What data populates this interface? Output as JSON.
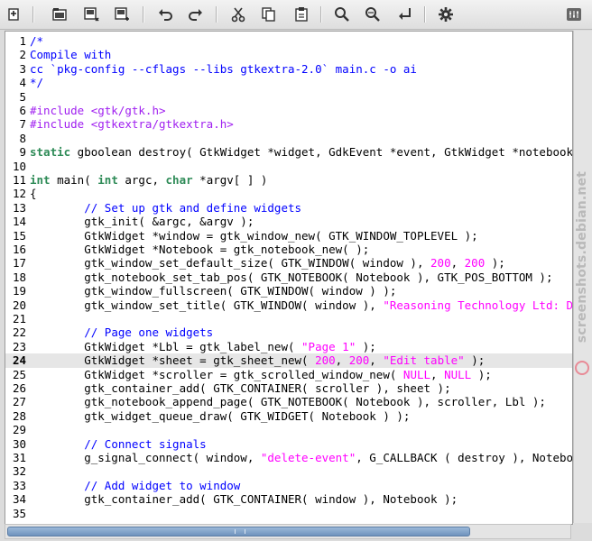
{
  "toolbar": {
    "buttons": [
      {
        "icon": "new-file-icon"
      },
      {
        "icon": "open-file-icon"
      },
      {
        "icon": "save-file-icon"
      },
      {
        "icon": "save-as-icon"
      },
      {
        "icon": "undo-icon"
      },
      {
        "icon": "redo-icon"
      },
      {
        "icon": "cut-icon"
      },
      {
        "icon": "copy-icon"
      },
      {
        "icon": "paste-icon"
      },
      {
        "icon": "find-icon"
      },
      {
        "icon": "find-next-icon"
      },
      {
        "icon": "goto-line-icon"
      },
      {
        "icon": "preferences-icon"
      },
      {
        "icon": "window-menu-icon"
      }
    ]
  },
  "editor": {
    "current_line": 24,
    "lines": [
      {
        "n": "1",
        "segs": [
          {
            "t": "/*",
            "c": "cmt"
          }
        ]
      },
      {
        "n": "2",
        "segs": [
          {
            "t": "Compile with",
            "c": "cmt"
          }
        ]
      },
      {
        "n": "3",
        "segs": [
          {
            "t": "cc `pkg-config --cflags --libs gtkextra-2.0` main.c -o ai",
            "c": "cmt"
          }
        ]
      },
      {
        "n": "4",
        "segs": [
          {
            "t": "*/",
            "c": "cmt"
          }
        ]
      },
      {
        "n": "5",
        "segs": []
      },
      {
        "n": "6",
        "segs": [
          {
            "t": "#include <gtk/gtk.h>",
            "c": "pre"
          }
        ]
      },
      {
        "n": "7",
        "segs": [
          {
            "t": "#include <gtkextra/gtkextra.h>",
            "c": "pre"
          }
        ]
      },
      {
        "n": "8",
        "segs": []
      },
      {
        "n": "9",
        "segs": [
          {
            "t": "static",
            "c": "kw"
          },
          {
            "t": " gboolean destroy( GtkWidget *widget, GdkEvent *event, GtkWidget *notebook"
          }
        ]
      },
      {
        "n": "10",
        "segs": []
      },
      {
        "n": "11",
        "segs": [
          {
            "t": "int",
            "c": "kw"
          },
          {
            "t": " main( "
          },
          {
            "t": "int",
            "c": "kw"
          },
          {
            "t": " argc, "
          },
          {
            "t": "char",
            "c": "kw"
          },
          {
            "t": " *argv[ ] )"
          }
        ]
      },
      {
        "n": "12",
        "segs": [
          {
            "t": "{"
          }
        ]
      },
      {
        "n": "13",
        "segs": [
          {
            "t": "        "
          },
          {
            "t": "// Set up gtk and define widgets",
            "c": "cmt"
          }
        ]
      },
      {
        "n": "14",
        "segs": [
          {
            "t": "        gtk_init( &argc, &argv );"
          }
        ]
      },
      {
        "n": "15",
        "segs": [
          {
            "t": "        GtkWidget *window = gtk_window_new( GTK_WINDOW_TOPLEVEL );"
          }
        ]
      },
      {
        "n": "16",
        "segs": [
          {
            "t": "        GtkWidget *Notebook = gtk_notebook_new( );"
          }
        ]
      },
      {
        "n": "17",
        "segs": [
          {
            "t": "        gtk_window_set_default_size( GTK_WINDOW( window ), "
          },
          {
            "t": "200",
            "c": "num"
          },
          {
            "t": ", "
          },
          {
            "t": "200",
            "c": "num"
          },
          {
            "t": " );"
          }
        ]
      },
      {
        "n": "18",
        "segs": [
          {
            "t": "        gtk_notebook_set_tab_pos( GTK_NOTEBOOK( Notebook ), GTK_POS_BOTTOM );"
          }
        ]
      },
      {
        "n": "19",
        "segs": [
          {
            "t": "        gtk_window_fullscreen( GTK_WINDOW( window ) );"
          }
        ]
      },
      {
        "n": "20",
        "segs": [
          {
            "t": "        gtk_window_set_title( GTK_WINDOW( window ), "
          },
          {
            "t": "\"Reasoning Technology Ltd: Dri",
            "c": "str"
          }
        ]
      },
      {
        "n": "21",
        "segs": []
      },
      {
        "n": "22",
        "segs": [
          {
            "t": "        "
          },
          {
            "t": "// Page one widgets",
            "c": "cmt"
          }
        ]
      },
      {
        "n": "23",
        "segs": [
          {
            "t": "        GtkWidget *Lbl = gtk_label_new( "
          },
          {
            "t": "\"Page 1\"",
            "c": "str"
          },
          {
            "t": " );"
          }
        ]
      },
      {
        "n": "24",
        "segs": [
          {
            "t": "        GtkWidget *sheet = gtk_sheet_new( "
          },
          {
            "t": "200",
            "c": "num"
          },
          {
            "t": ", "
          },
          {
            "t": "200",
            "c": "num"
          },
          {
            "t": ", "
          },
          {
            "t": "\"Edit table\"",
            "c": "str"
          },
          {
            "t": " );"
          }
        ]
      },
      {
        "n": "25",
        "segs": [
          {
            "t": "        GtkWidget *scroller = gtk_scrolled_window_new( "
          },
          {
            "t": "NULL",
            "c": "num"
          },
          {
            "t": ", "
          },
          {
            "t": "NULL",
            "c": "num"
          },
          {
            "t": " );"
          }
        ]
      },
      {
        "n": "26",
        "segs": [
          {
            "t": "        gtk_container_add( GTK_CONTAINER( scroller ), sheet );"
          }
        ]
      },
      {
        "n": "27",
        "segs": [
          {
            "t": "        gtk_notebook_append_page( GTK_NOTEBOOK( Notebook ), scroller, Lbl );"
          }
        ]
      },
      {
        "n": "28",
        "segs": [
          {
            "t": "        gtk_widget_queue_draw( GTK_WIDGET( Notebook ) );"
          }
        ]
      },
      {
        "n": "29",
        "segs": []
      },
      {
        "n": "30",
        "segs": [
          {
            "t": "        "
          },
          {
            "t": "// Connect signals",
            "c": "cmt"
          }
        ]
      },
      {
        "n": "31",
        "segs": [
          {
            "t": "        g_signal_connect( window, "
          },
          {
            "t": "\"delete-event\"",
            "c": "str"
          },
          {
            "t": ", G_CALLBACK ( destroy ), Notebook"
          }
        ]
      },
      {
        "n": "32",
        "segs": []
      },
      {
        "n": "33",
        "segs": [
          {
            "t": "        "
          },
          {
            "t": "// Add widget to window",
            "c": "cmt"
          }
        ]
      },
      {
        "n": "34",
        "segs": [
          {
            "t": "        gtk_container_add( GTK_CONTAINER( window ), Notebook );"
          }
        ]
      },
      {
        "n": "35",
        "segs": []
      }
    ]
  },
  "watermark": {
    "text": "screenshots.debian.net"
  },
  "colors": {
    "comment": "#0000ff",
    "preprocessor": "#a020f0",
    "string": "#ff00ff",
    "keyword": "#2e8b57",
    "current_line_bg": "#e6e6e6"
  }
}
